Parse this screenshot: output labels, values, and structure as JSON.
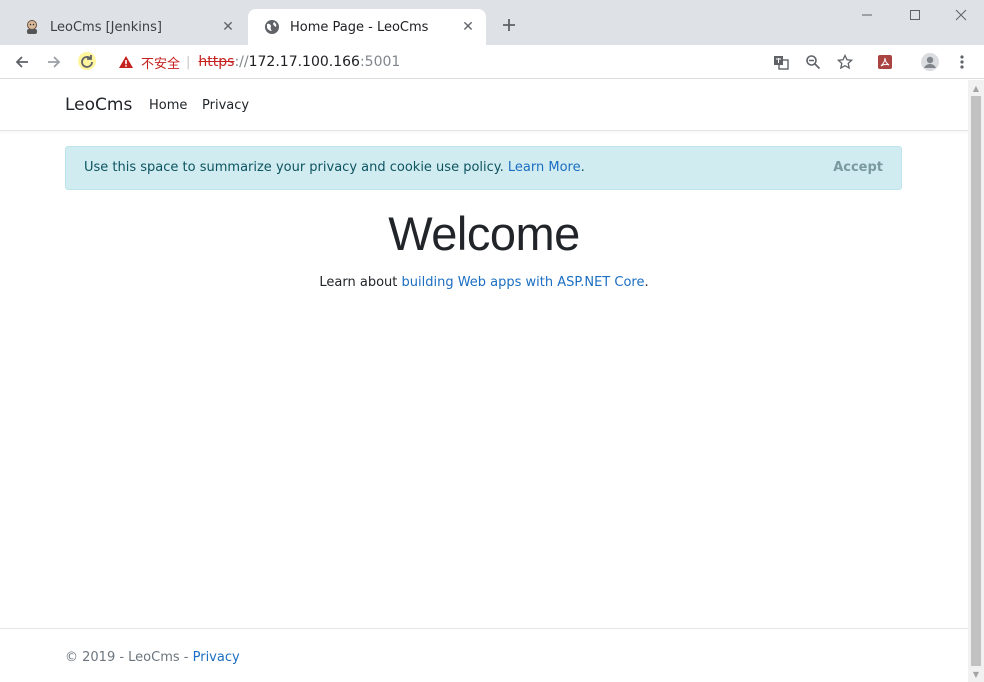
{
  "browser": {
    "tabs": [
      {
        "title": "LeoCms [Jenkins]",
        "favicon": "jenkins-icon",
        "active": false
      },
      {
        "title": "Home Page - LeoCms",
        "favicon": "globe-icon",
        "active": true
      }
    ],
    "security_label": "不安全",
    "url": {
      "scheme": "https",
      "separator": "://",
      "host": "172.17.100.166",
      "port": ":5001"
    }
  },
  "site": {
    "brand": "LeoCms",
    "nav": [
      {
        "label": "Home"
      },
      {
        "label": "Privacy"
      }
    ],
    "cookie_notice": {
      "message": "Use this space to summarize your privacy and cookie use policy.",
      "link_text": "Learn More",
      "link_suffix": ".",
      "accept_label": "Accept"
    },
    "welcome": {
      "heading": "Welcome",
      "lead_prefix": "Learn about ",
      "lead_link": "building Web apps with ASP.NET Core",
      "lead_suffix": "."
    },
    "footer": {
      "copyright": "© 2019 - LeoCms - ",
      "privacy_link": "Privacy"
    }
  },
  "colors": {
    "link": "#1b6ec2",
    "alert_bg": "#d1ecf1",
    "insecure": "#c5221f"
  }
}
